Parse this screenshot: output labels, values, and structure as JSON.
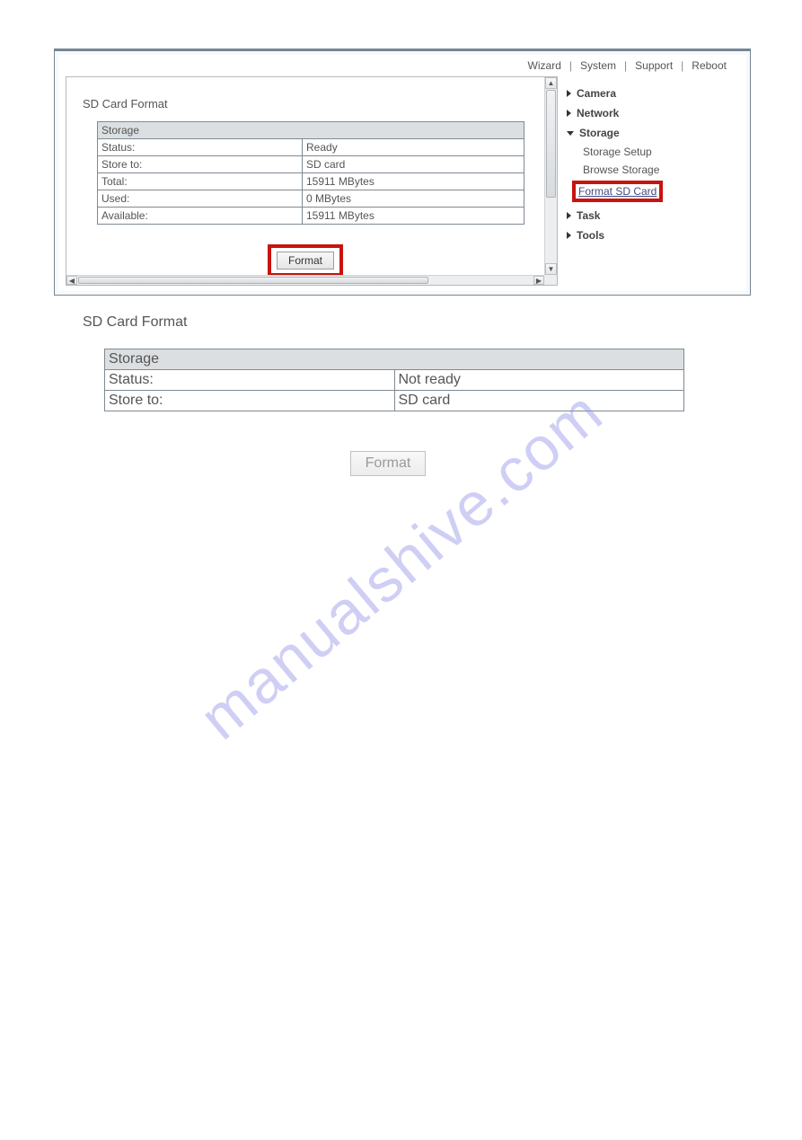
{
  "toplinks": {
    "wizard": "Wizard",
    "system": "System",
    "support": "Support",
    "reboot": "Reboot"
  },
  "panel1": {
    "title": "SD Card Format",
    "table_header": "Storage",
    "rows": [
      {
        "key": "Status:",
        "value": "Ready"
      },
      {
        "key": "Store to:",
        "value": "SD card"
      },
      {
        "key": "Total:",
        "value": "15911 MBytes"
      },
      {
        "key": "Used:",
        "value": "0 MBytes"
      },
      {
        "key": "Available:",
        "value": "15911 MBytes"
      }
    ],
    "format_label": "Format"
  },
  "nav": {
    "camera": "Camera",
    "network": "Network",
    "storage": "Storage",
    "storage_setup": "Storage Setup",
    "browse_storage": "Browse Storage",
    "format_sd": "Format SD Card",
    "task": "Task",
    "tools": "Tools"
  },
  "panel2": {
    "title": "SD Card Format",
    "table_header": "Storage",
    "rows": [
      {
        "key": "Status:",
        "value": "Not ready"
      },
      {
        "key": "Store to:",
        "value": "SD card"
      }
    ],
    "format_label": "Format"
  },
  "watermark": "manualshive.com"
}
